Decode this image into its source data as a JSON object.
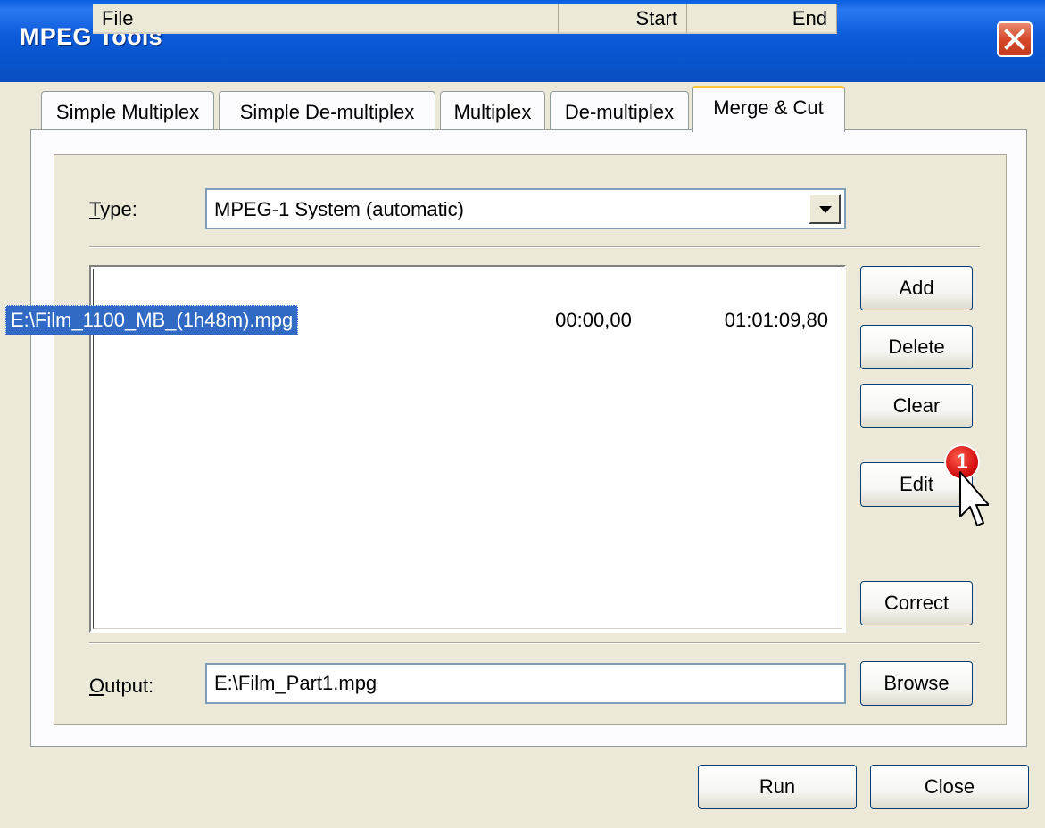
{
  "window": {
    "title": "MPEG Tools"
  },
  "tabs": [
    {
      "label": "Simple Multiplex"
    },
    {
      "label": "Simple De-multiplex"
    },
    {
      "label": "Multiplex"
    },
    {
      "label": "De-multiplex"
    },
    {
      "label": "Merge & Cut",
      "active": true
    }
  ],
  "type": {
    "label_prefix": "",
    "label_mnemonic": "T",
    "label_rest": "ype:",
    "selected": "MPEG-1 System (automatic)"
  },
  "list": {
    "columns": [
      "File",
      "Start",
      "End"
    ],
    "rows": [
      {
        "file": "E:\\Film_1100_MB_(1h48m).mpg",
        "start": "00:00,00",
        "end": "01:01:09,80",
        "selected": true
      }
    ]
  },
  "side_buttons": {
    "add": "Add",
    "delete": "Delete",
    "clear": "Clear",
    "edit": "Edit",
    "correct": "Correct"
  },
  "output": {
    "label_mnemonic": "O",
    "label_rest": "utput:",
    "value": "E:\\Film_Part1.mpg",
    "browse": "Browse"
  },
  "footer": {
    "run": "Run",
    "close": "Close"
  },
  "annotation": {
    "badge": "1"
  },
  "colors": {
    "titlebar": "#0753c9",
    "selection": "#316ac5",
    "badge": "#d10f0f"
  }
}
